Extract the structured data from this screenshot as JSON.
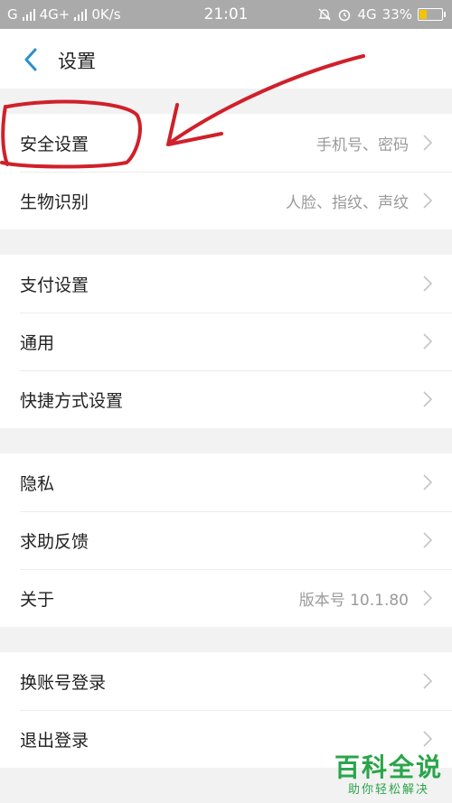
{
  "status_bar": {
    "left_text": "G",
    "network_text": "4G+",
    "speed_text": "0K/s",
    "time": "21:01",
    "right_network_text": "4G",
    "battery_percent": "33%",
    "battery_level": 0.33
  },
  "header": {
    "back_icon": "chevron-left-icon",
    "title": "设置"
  },
  "groups": [
    [
      {
        "label": "安全设置",
        "value": "手机号、密码"
      },
      {
        "label": "生物识别",
        "value": "人脸、指纹、声纹"
      }
    ],
    [
      {
        "label": "支付设置",
        "value": ""
      },
      {
        "label": "通用",
        "value": ""
      },
      {
        "label": "快捷方式设置",
        "value": ""
      }
    ],
    [
      {
        "label": "隐私",
        "value": ""
      },
      {
        "label": "求助反馈",
        "value": ""
      },
      {
        "label": "关于",
        "value": "版本号 10.1.80"
      }
    ],
    [
      {
        "label": "换账号登录",
        "value": ""
      },
      {
        "label": "退出登录",
        "value": ""
      }
    ]
  ],
  "annotation": {
    "color": "#d0202a",
    "target": "安全设置"
  },
  "watermark": {
    "title": "百科全说",
    "subtitle": "助你轻松解决"
  },
  "colors": {
    "accent": "#2a8fd0",
    "status_bar": "#aaaaaa",
    "background": "#f2f2f2",
    "watermark": "#2aa54a"
  }
}
